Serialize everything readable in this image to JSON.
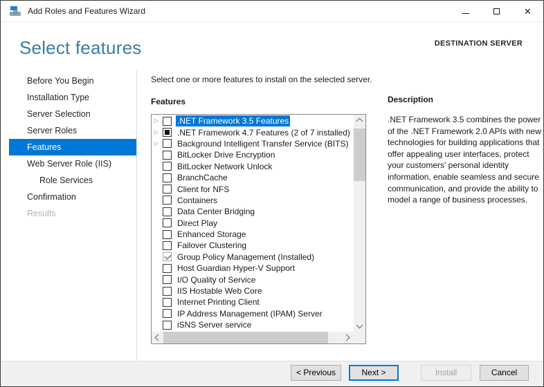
{
  "colors": {
    "accent": "#0078d7",
    "heading_blue": "#3a7ca8",
    "selected_text": "#ffffff"
  },
  "window": {
    "title": "Add Roles and Features Wizard"
  },
  "header": {
    "title": "Select features",
    "destination_label": "DESTINATION SERVER"
  },
  "sidebar": {
    "items": [
      {
        "label": "Before You Begin",
        "state": "normal"
      },
      {
        "label": "Installation Type",
        "state": "normal"
      },
      {
        "label": "Server Selection",
        "state": "normal"
      },
      {
        "label": "Server Roles",
        "state": "normal"
      },
      {
        "label": "Features",
        "state": "selected"
      },
      {
        "label": "Web Server Role (IIS)",
        "state": "normal"
      },
      {
        "label": "Role Services",
        "state": "indent"
      },
      {
        "label": "Confirmation",
        "state": "normal"
      },
      {
        "label": "Results",
        "state": "disabled"
      }
    ]
  },
  "main": {
    "instruction": "Select one or more features to install on the selected server.",
    "features_label": "Features",
    "features": [
      {
        "label": ".NET Framework 3.5 Features",
        "checkbox": "unchecked",
        "expander": true,
        "selected": true
      },
      {
        "label": ".NET Framework 4.7 Features (2 of 7 installed)",
        "checkbox": "indeterminate",
        "expander": true,
        "selected": false
      },
      {
        "label": "Background Intelligent Transfer Service (BITS)",
        "checkbox": "unchecked",
        "expander": true,
        "selected": false
      },
      {
        "label": "BitLocker Drive Encryption",
        "checkbox": "unchecked",
        "expander": false,
        "selected": false
      },
      {
        "label": "BitLocker Network Unlock",
        "checkbox": "unchecked",
        "expander": false,
        "selected": false
      },
      {
        "label": "BranchCache",
        "checkbox": "unchecked",
        "expander": false,
        "selected": false
      },
      {
        "label": "Client for NFS",
        "checkbox": "unchecked",
        "expander": false,
        "selected": false
      },
      {
        "label": "Containers",
        "checkbox": "unchecked",
        "expander": false,
        "selected": false
      },
      {
        "label": "Data Center Bridging",
        "checkbox": "unchecked",
        "expander": false,
        "selected": false
      },
      {
        "label": "Direct Play",
        "checkbox": "unchecked",
        "expander": false,
        "selected": false
      },
      {
        "label": "Enhanced Storage",
        "checkbox": "unchecked",
        "expander": false,
        "selected": false
      },
      {
        "label": "Failover Clustering",
        "checkbox": "unchecked",
        "expander": false,
        "selected": false
      },
      {
        "label": "Group Policy Management (Installed)",
        "checkbox": "disabled-checked",
        "expander": false,
        "selected": false
      },
      {
        "label": "Host Guardian Hyper-V Support",
        "checkbox": "unchecked",
        "expander": false,
        "selected": false
      },
      {
        "label": "I/O Quality of Service",
        "checkbox": "unchecked",
        "expander": false,
        "selected": false
      },
      {
        "label": "IIS Hostable Web Core",
        "checkbox": "unchecked",
        "expander": false,
        "selected": false
      },
      {
        "label": "Internet Printing Client",
        "checkbox": "unchecked",
        "expander": false,
        "selected": false
      },
      {
        "label": "IP Address Management (IPAM) Server",
        "checkbox": "unchecked",
        "expander": false,
        "selected": false
      },
      {
        "label": "iSNS Server service",
        "checkbox": "unchecked",
        "expander": false,
        "selected": false
      }
    ]
  },
  "description": {
    "heading": "Description",
    "text": ".NET Framework 3.5 combines the power of the .NET Framework 2.0 APIs with new technologies for building applications that offer appealing user interfaces, protect your customers' personal identity information, enable seamless and secure communication, and provide the ability to model a range of business processes."
  },
  "footer": {
    "buttons": [
      {
        "id": "previous",
        "label": "< Previous",
        "state": "normal"
      },
      {
        "id": "next",
        "label": "Next >",
        "state": "focused"
      },
      {
        "id": "install",
        "label": "Install",
        "state": "disabled"
      },
      {
        "id": "cancel",
        "label": "Cancel",
        "state": "normal"
      }
    ]
  }
}
